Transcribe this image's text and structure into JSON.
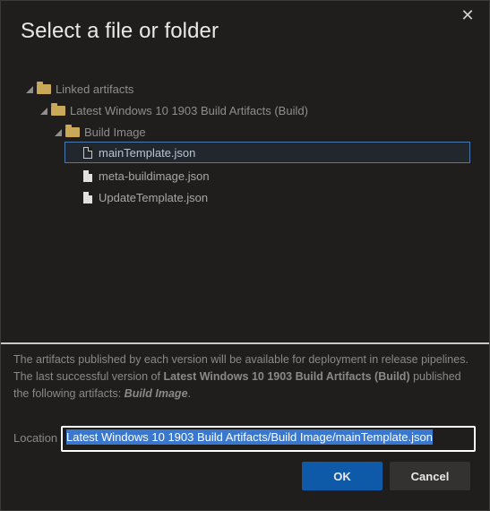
{
  "dialog": {
    "title": "Select a file or folder",
    "close_glyph": "✕"
  },
  "tree": {
    "root": {
      "label": "Linked artifacts",
      "icon": "folder-icon"
    },
    "artifact": {
      "label": "Latest Windows 10 1903 Build Artifacts (Build)",
      "icon": "folder-icon"
    },
    "folder": {
      "label": "Build Image",
      "icon": "folder-icon"
    },
    "files": [
      {
        "label": "mainTemplate.json",
        "icon": "file-icon",
        "selected": true
      },
      {
        "label": "meta-buildimage.json",
        "icon": "file-icon",
        "selected": false
      },
      {
        "label": "UpdateTemplate.json",
        "icon": "file-icon",
        "selected": false
      }
    ]
  },
  "info": {
    "part1": "The artifacts published by each version will be available for deployment in release pipelines. The last successful version of ",
    "artifact_name": "Latest Windows 10 1903 Build Artifacts (Build)",
    "part2": " published the following artifacts: ",
    "artifacts_list": "Build Image",
    "part3": "."
  },
  "location": {
    "label": "Location",
    "value": "Latest Windows 10 1903 Build Artifacts/Build Image/mainTemplate.json"
  },
  "buttons": {
    "ok_label": "OK",
    "cancel_label": "Cancel"
  },
  "colors": {
    "accent": "#0f5aa8",
    "selection_border": "#4a78b0",
    "folder": "#c9a857"
  }
}
